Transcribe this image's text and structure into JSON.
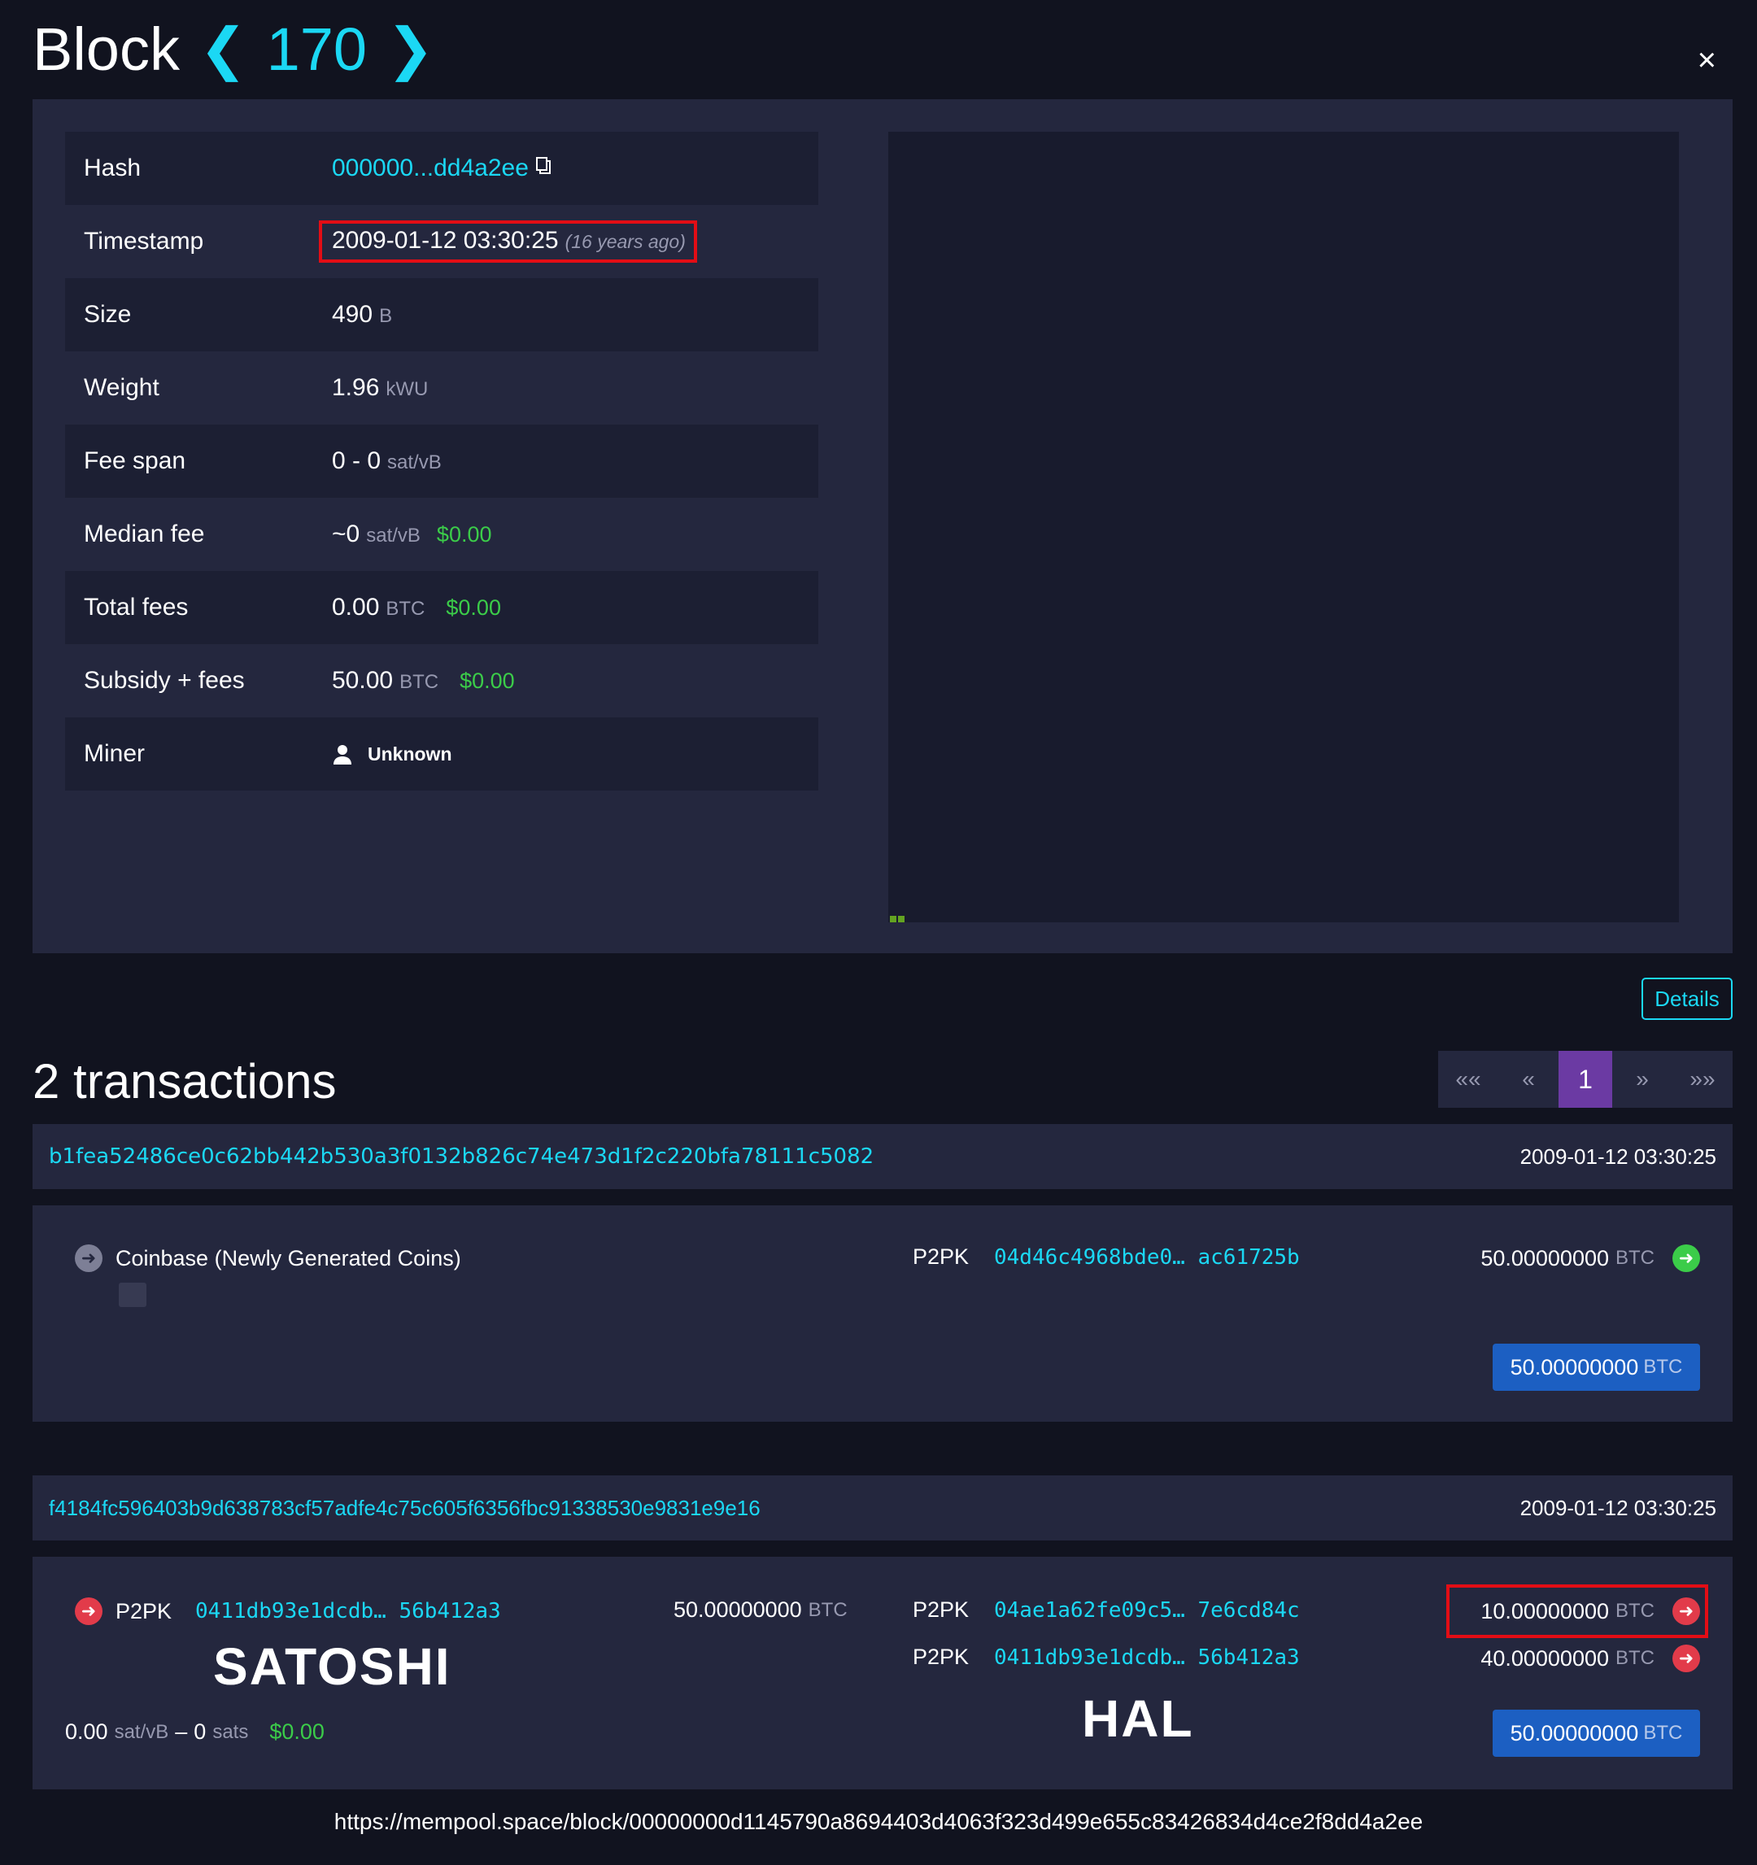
{
  "header": {
    "title_label": "Block",
    "block_number": "170",
    "prev_icon": "chevron-left-icon",
    "next_icon": "chevron-right-icon",
    "close_icon": "close-icon",
    "close_glyph": "×"
  },
  "block_info": {
    "rows": [
      {
        "key": "Hash",
        "value": "000000...dd4a2ee"
      },
      {
        "key": "Timestamp",
        "value": "2009-01-12 03:30:25",
        "sub": "(16 years ago)"
      },
      {
        "key": "Size",
        "value": "490",
        "unit": "B"
      },
      {
        "key": "Weight",
        "value": "1.96",
        "unit": "kWU"
      },
      {
        "key": "Fee span",
        "value": "0 - 0",
        "unit": "sat/vB"
      },
      {
        "key": "Median fee",
        "value": "~0",
        "unit": "sat/vB",
        "fiat": "$0.00"
      },
      {
        "key": "Total fees",
        "value": "0.00",
        "unit": "BTC",
        "fiat": "$0.00"
      },
      {
        "key": "Subsidy + fees",
        "value": "50.00",
        "unit": "BTC",
        "fiat": "$0.00"
      },
      {
        "key": "Miner",
        "value": "Unknown"
      }
    ]
  },
  "details_button": "Details",
  "transactions_heading": "2 transactions",
  "pagination": {
    "first": "««",
    "prev": "«",
    "current": "1",
    "next": "»",
    "last": "»»"
  },
  "transactions": [
    {
      "txid": "b1fea52486ce0c62bb442b530a3f0132b826c74e473d1f2c220bfa78111c5082",
      "time": "2009-01-12 03:30:25",
      "input_label": "Coinbase (Newly Generated Coins)",
      "outputs": [
        {
          "type": "P2PK",
          "address": "04d46c4968bde0… ac61725b",
          "amount": "50.00000000",
          "unit": "BTC"
        }
      ],
      "total": "50.00000000",
      "total_unit": "BTC"
    },
    {
      "txid": "f4184fc596403b9d638783cf57adfe4c75c605f6356fbc91338530e9831e9e16",
      "time": "2009-01-12 03:30:25",
      "inputs": [
        {
          "type": "P2PK",
          "address": "0411db93e1dcdb… 56b412a3",
          "amount": "50.00000000",
          "unit": "BTC"
        }
      ],
      "outputs": [
        {
          "type": "P2PK",
          "address": "04ae1a62fe09c5… 7e6cd84c",
          "amount": "10.00000000",
          "unit": "BTC"
        },
        {
          "type": "P2PK",
          "address": "0411db93e1dcdb… 56b412a3",
          "amount": "40.00000000",
          "unit": "BTC"
        }
      ],
      "fee": {
        "rate": "0.00",
        "rate_unit": "sat/vB",
        "sep": "–",
        "sats": "0",
        "sats_unit": "sats",
        "fiat": "$0.00"
      },
      "total": "50.00000000",
      "total_unit": "BTC",
      "annotation_sender": "SATOSHI",
      "annotation_receiver": "HAL"
    }
  ],
  "footer_url": "https://mempool.space/block/00000000d1145790a8694403d4063f323d499e655c83426834d4ce2f8dd4a2ee",
  "colors": {
    "accent": "#1bd8f4",
    "fiat": "#3bcc49",
    "highlight_box": "#e30d15",
    "pager_active": "#6b3aa3",
    "total_badge": "#1c5fc2"
  }
}
